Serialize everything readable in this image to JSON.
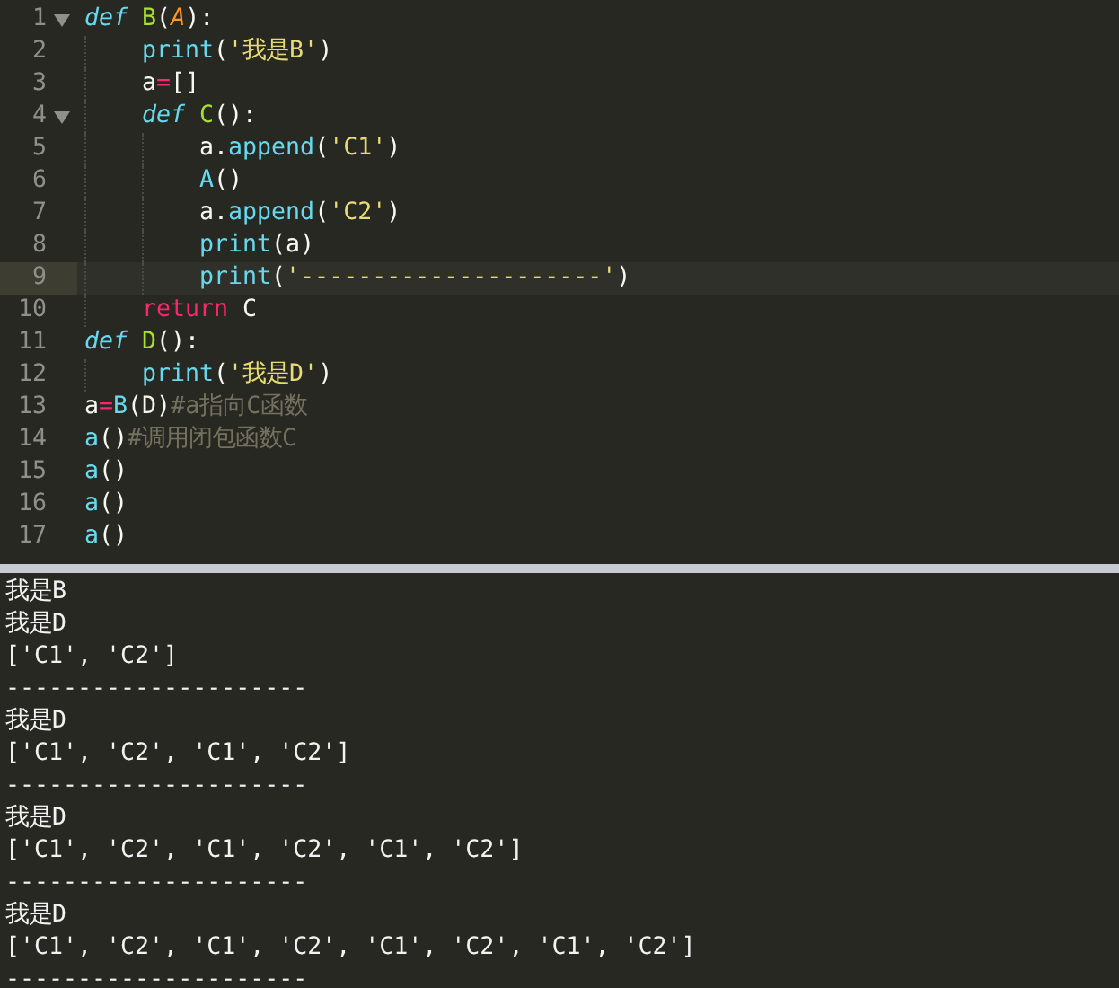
{
  "editor": {
    "lines": [
      {
        "number": "1",
        "foldable": true,
        "current": false,
        "tokens": [
          {
            "kind": "keyword",
            "text": "def"
          },
          {
            "kind": "function",
            "text": " B"
          },
          {
            "kind": "plain",
            "text": "("
          },
          {
            "kind": "parameter",
            "text": "A"
          },
          {
            "kind": "plain",
            "text": "):"
          }
        ],
        "children": [
          {
            "number": "2",
            "foldable": false,
            "current": false,
            "tokens": [
              {
                "kind": "builtin",
                "text": "print"
              },
              {
                "kind": "plain",
                "text": "("
              },
              {
                "kind": "string",
                "text": "'我是B'"
              },
              {
                "kind": "plain",
                "text": ")"
              }
            ]
          },
          {
            "number": "3",
            "foldable": false,
            "current": false,
            "tokens": [
              {
                "kind": "plain",
                "text": "a"
              },
              {
                "kind": "operator",
                "text": "="
              },
              {
                "kind": "plain",
                "text": "[]"
              }
            ]
          },
          {
            "number": "4",
            "foldable": true,
            "current": false,
            "tokens": [
              {
                "kind": "keyword",
                "text": "def"
              },
              {
                "kind": "function",
                "text": " C"
              },
              {
                "kind": "plain",
                "text": "():"
              }
            ],
            "children": [
              {
                "number": "5",
                "foldable": false,
                "current": false,
                "tokens": [
                  {
                    "kind": "plain",
                    "text": "a."
                  },
                  {
                    "kind": "builtin",
                    "text": "append"
                  },
                  {
                    "kind": "plain",
                    "text": "("
                  },
                  {
                    "kind": "string",
                    "text": "'C1'"
                  },
                  {
                    "kind": "plain",
                    "text": ")"
                  }
                ]
              },
              {
                "number": "6",
                "foldable": false,
                "current": false,
                "tokens": [
                  {
                    "kind": "builtin",
                    "text": "A"
                  },
                  {
                    "kind": "plain",
                    "text": "()"
                  }
                ]
              },
              {
                "number": "7",
                "foldable": false,
                "current": false,
                "tokens": [
                  {
                    "kind": "plain",
                    "text": "a."
                  },
                  {
                    "kind": "builtin",
                    "text": "append"
                  },
                  {
                    "kind": "plain",
                    "text": "("
                  },
                  {
                    "kind": "string",
                    "text": "'C2'"
                  },
                  {
                    "kind": "plain",
                    "text": ")"
                  }
                ]
              },
              {
                "number": "8",
                "foldable": false,
                "current": false,
                "tokens": [
                  {
                    "kind": "builtin",
                    "text": "print"
                  },
                  {
                    "kind": "plain",
                    "text": "(a)"
                  }
                ]
              },
              {
                "number": "9",
                "foldable": false,
                "current": true,
                "tokens": [
                  {
                    "kind": "builtin",
                    "text": "print"
                  },
                  {
                    "kind": "plain",
                    "text": "("
                  },
                  {
                    "kind": "string",
                    "text": "'---------------------'"
                  },
                  {
                    "kind": "plain",
                    "text": ")"
                  }
                ]
              }
            ]
          },
          {
            "number": "10",
            "foldable": false,
            "current": false,
            "tokens": [
              {
                "kind": "operator",
                "text": "return"
              },
              {
                "kind": "plain",
                "text": " C"
              }
            ]
          }
        ]
      },
      {
        "number": "11",
        "foldable": false,
        "current": false,
        "tokens": [
          {
            "kind": "keyword",
            "text": "def"
          },
          {
            "kind": "function",
            "text": " D"
          },
          {
            "kind": "plain",
            "text": "():"
          }
        ],
        "children": [
          {
            "number": "12",
            "foldable": false,
            "current": false,
            "tokens": [
              {
                "kind": "builtin",
                "text": "print"
              },
              {
                "kind": "plain",
                "text": "("
              },
              {
                "kind": "string",
                "text": "'我是D'"
              },
              {
                "kind": "plain",
                "text": ")"
              }
            ]
          }
        ]
      },
      {
        "number": "13",
        "foldable": false,
        "current": false,
        "tokens": [
          {
            "kind": "plain",
            "text": "a"
          },
          {
            "kind": "operator",
            "text": "="
          },
          {
            "kind": "builtin",
            "text": "B"
          },
          {
            "kind": "plain",
            "text": "(D)"
          },
          {
            "kind": "comment",
            "text": "#a指向C函数"
          }
        ]
      },
      {
        "number": "14",
        "foldable": false,
        "current": false,
        "tokens": [
          {
            "kind": "builtin",
            "text": "a"
          },
          {
            "kind": "plain",
            "text": "()"
          },
          {
            "kind": "comment",
            "text": "#调用闭包函数C"
          }
        ]
      },
      {
        "number": "15",
        "foldable": false,
        "current": false,
        "tokens": [
          {
            "kind": "builtin",
            "text": "a"
          },
          {
            "kind": "plain",
            "text": "()"
          }
        ]
      },
      {
        "number": "16",
        "foldable": false,
        "current": false,
        "tokens": [
          {
            "kind": "builtin",
            "text": "a"
          },
          {
            "kind": "plain",
            "text": "()"
          }
        ]
      },
      {
        "number": "17",
        "foldable": false,
        "current": false,
        "tokens": [
          {
            "kind": "builtin",
            "text": "a"
          },
          {
            "kind": "plain",
            "text": "()"
          }
        ]
      }
    ]
  },
  "output": {
    "lines": [
      "我是B",
      "我是D",
      "['C1', 'C2']",
      "---------------------",
      "我是D",
      "['C1', 'C2', 'C1', 'C2']",
      "---------------------",
      "我是D",
      "['C1', 'C2', 'C1', 'C2', 'C1', 'C2']",
      "---------------------",
      "我是D",
      "['C1', 'C2', 'C1', 'C2', 'C1', 'C2', 'C1', 'C2']",
      "---------------------"
    ]
  }
}
